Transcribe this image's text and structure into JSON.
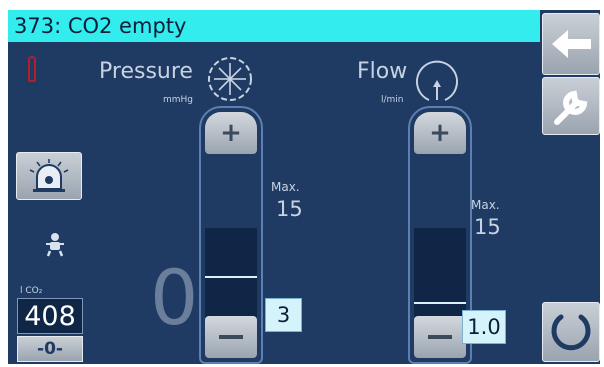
{
  "alarm": {
    "text": "373: CO2 empty"
  },
  "pressure": {
    "label": "Pressure",
    "unit": "mmHg",
    "max_label": "Max.",
    "max_value": "15",
    "set_value": "3",
    "plus": "+",
    "measured_value": "0"
  },
  "flow": {
    "label": "Flow",
    "unit": "l/min",
    "max_label": "Max.",
    "max_value": "15",
    "set_value": "1.0",
    "plus": "+"
  },
  "co2": {
    "label": "l CO₂",
    "value": "408",
    "reset_label": "-0-"
  },
  "icons": {
    "back": "back-arrow-icon",
    "settings": "wrench-icon",
    "power": "power-icon",
    "alarm_bell": "alarm-bell-icon",
    "patient": "baby-icon",
    "gas": "gas-cylinder-icon"
  },
  "colors": {
    "alarm_bar": "#33ecee",
    "background": "#1f3b63",
    "value_box": "#d4f3fb",
    "gas_warning": "#b81e28"
  }
}
